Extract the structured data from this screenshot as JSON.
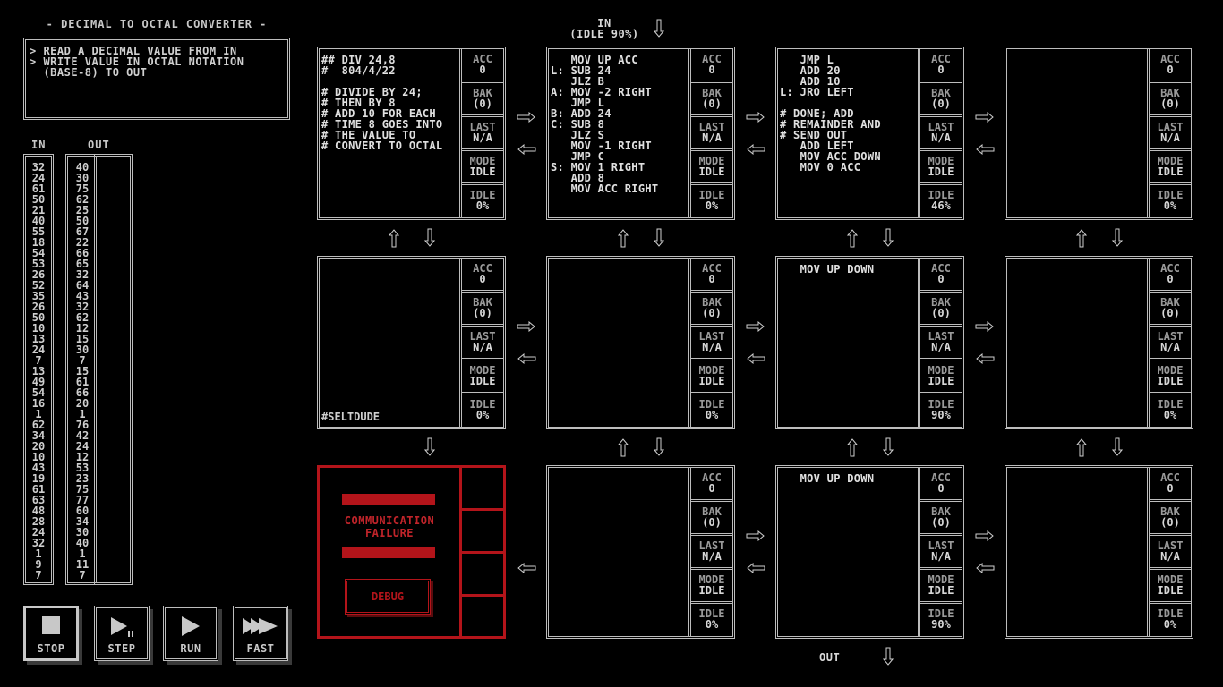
{
  "puzzle": {
    "title": "- DECIMAL TO OCTAL CONVERTER -",
    "description": [
      "> READ A DECIMAL VALUE FROM IN",
      "> WRITE VALUE IN OCTAL NOTATION",
      "  (BASE-8) TO OUT"
    ]
  },
  "io": {
    "in_label": "IN",
    "out_label": "OUT",
    "in_values": [
      "32",
      "24",
      "61",
      "50",
      "21",
      "40",
      "55",
      "18",
      "54",
      "53",
      "26",
      "52",
      "35",
      "26",
      "50",
      "10",
      "13",
      "24",
      "7",
      "13",
      "49",
      "54",
      "16",
      "1",
      "62",
      "34",
      "20",
      "10",
      "43",
      "19",
      "61",
      "63",
      "48",
      "28",
      "24",
      "32",
      "1",
      "9",
      "7"
    ],
    "expected_out": [
      "40",
      "30",
      "75",
      "62",
      "25",
      "50",
      "67",
      "22",
      "66",
      "65",
      "32",
      "64",
      "43",
      "32",
      "62",
      "12",
      "15",
      "30",
      "7",
      "15",
      "61",
      "66",
      "20",
      "1",
      "76",
      "42",
      "24",
      "12",
      "53",
      "23",
      "75",
      "77",
      "60",
      "34",
      "30",
      "40",
      "1",
      "11",
      "7"
    ],
    "actual_out": []
  },
  "controls": {
    "stop": "STOP",
    "step": "STEP",
    "run": "RUN",
    "fast": "FAST"
  },
  "top_port": {
    "label": "IN",
    "status": "(IDLE 90%)"
  },
  "bottom_port": {
    "label": "OUT"
  },
  "colors": {
    "fg": "#d8d8d8",
    "border": "#bdbdbd",
    "dim": "#9a9a9a",
    "error": "#b3141a"
  },
  "register_labels": {
    "acc": "ACC",
    "bak": "BAK",
    "last": "LAST",
    "mode": "MODE",
    "idle": "IDLE"
  },
  "nodes": [
    {
      "code": "## DIV 24,8\n#  804/4/22\n\n# DIVIDE BY 24;\n# THEN BY 8\n# ADD 10 FOR EACH\n# TIME 8 GOES INTO\n# THE VALUE TO\n# CONVERT TO OCTAL",
      "acc": "0",
      "bak": "(0)",
      "last": "N/A",
      "mode": "IDLE",
      "idle": "0%"
    },
    {
      "code": "   MOV UP ACC\nL: SUB 24\n   JLZ B\nA: MOV -2 RIGHT\n   JMP L\nB: ADD 24\nC: SUB 8\n   JLZ S\n   MOV -1 RIGHT\n   JMP C\nS: MOV 1 RIGHT\n   ADD 8\n   MOV ACC RIGHT",
      "acc": "0",
      "bak": "(0)",
      "last": "N/A",
      "mode": "IDLE",
      "idle": "0%"
    },
    {
      "code": "   JMP L\n   ADD 20\n   ADD 10\nL: JRO LEFT\n\n# DONE; ADD\n# REMAINDER AND\n# SEND OUT\n   ADD LEFT\n   MOV ACC DOWN\n   MOV 0 ACC",
      "acc": "0",
      "bak": "(0)",
      "last": "N/A",
      "mode": "IDLE",
      "idle": "46%"
    },
    {
      "code": "",
      "acc": "0",
      "bak": "(0)",
      "last": "N/A",
      "mode": "IDLE",
      "idle": "0%"
    },
    {
      "code": "",
      "footer": "#SELTDUDE",
      "acc": "0",
      "bak": "(0)",
      "last": "N/A",
      "mode": "IDLE",
      "idle": "0%"
    },
    {
      "code": "",
      "acc": "0",
      "bak": "(0)",
      "last": "N/A",
      "mode": "IDLE",
      "idle": "0%"
    },
    {
      "code": "   MOV UP DOWN",
      "acc": "0",
      "bak": "(0)",
      "last": "N/A",
      "mode": "IDLE",
      "idle": "90%"
    },
    {
      "code": "",
      "acc": "0",
      "bak": "(0)",
      "last": "N/A",
      "mode": "IDLE",
      "idle": "0%"
    },
    {
      "failure": true,
      "message": "COMMUNICATION\nFAILURE",
      "debug_label": "DEBUG"
    },
    {
      "code": "",
      "acc": "0",
      "bak": "(0)",
      "last": "N/A",
      "mode": "IDLE",
      "idle": "0%"
    },
    {
      "code": "   MOV UP DOWN",
      "acc": "0",
      "bak": "(0)",
      "last": "N/A",
      "mode": "IDLE",
      "idle": "90%"
    },
    {
      "code": "",
      "acc": "0",
      "bak": "(0)",
      "last": "N/A",
      "mode": "IDLE",
      "idle": "0%"
    }
  ]
}
